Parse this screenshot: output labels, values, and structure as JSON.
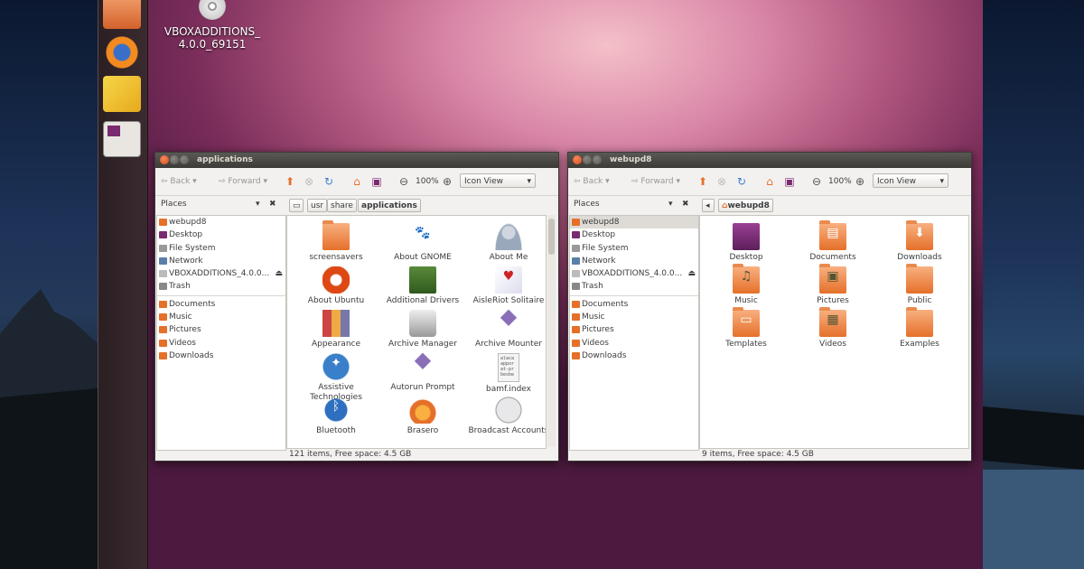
{
  "desktop": {
    "icon_label": "VBOXADDITIONS_\n4.0.0_69151"
  },
  "left_window": {
    "title": "applications",
    "toolbar": {
      "back": "Back",
      "forward": "Forward",
      "zoom": "100%",
      "view": "Icon View"
    },
    "places_label": "Places",
    "path": [
      "usr",
      "share",
      "applications"
    ],
    "sidebar": [
      {
        "label": "webupd8",
        "icon": "home-folder-icon"
      },
      {
        "label": "Desktop",
        "icon": "desktop-icon"
      },
      {
        "label": "File System",
        "icon": "drive-icon"
      },
      {
        "label": "Network",
        "icon": "network-icon"
      },
      {
        "label": "VBOXADDITIONS_4.0.0...",
        "icon": "disc-icon",
        "eject": "⏏"
      },
      {
        "label": "Trash",
        "icon": "trash-icon"
      },
      {
        "label": "Documents",
        "icon": "folder-icon"
      },
      {
        "label": "Music",
        "icon": "folder-icon"
      },
      {
        "label": "Pictures",
        "icon": "folder-icon"
      },
      {
        "label": "Videos",
        "icon": "folder-icon"
      },
      {
        "label": "Downloads",
        "icon": "folder-icon"
      }
    ],
    "files": [
      {
        "label": "screensavers",
        "icon": "folder-icon"
      },
      {
        "label": "About GNOME",
        "icon": "gnome-foot-icon"
      },
      {
        "label": "About Me",
        "icon": "user-info-icon"
      },
      {
        "label": "About Ubuntu",
        "icon": "ubuntu-logo-icon"
      },
      {
        "label": "Additional Drivers",
        "icon": "circuit-board-icon"
      },
      {
        "label": "AisleRiot Solitaire",
        "icon": "cards-icon"
      },
      {
        "label": "Appearance",
        "icon": "appearance-icon"
      },
      {
        "label": "Archive Manager",
        "icon": "archive-icon"
      },
      {
        "label": "Archive Mounter",
        "icon": "diamond-archive-icon"
      },
      {
        "label": "Assistive Technologies",
        "icon": "accessibility-icon"
      },
      {
        "label": "Autorun Prompt",
        "icon": "diamond-archive-icon"
      },
      {
        "label": "bamf.index",
        "icon": "text-file-icon"
      },
      {
        "label": "Bluetooth",
        "icon": "bluetooth-icon"
      },
      {
        "label": "Brasero",
        "icon": "brasero-icon"
      },
      {
        "label": "Broadcast Accounts",
        "icon": "chat-bubble-icon"
      }
    ],
    "text_file_preview": "alaca\nappor\nat-pr\nbesbe",
    "status": "121 items, Free space: 4.5 GB"
  },
  "right_window": {
    "title": "webupd8",
    "toolbar": {
      "back": "Back",
      "forward": "Forward",
      "zoom": "100%",
      "view": "Icon View"
    },
    "places_label": "Places",
    "path": [
      "webupd8"
    ],
    "sidebar": [
      {
        "label": "webupd8",
        "icon": "home-folder-icon"
      },
      {
        "label": "Desktop",
        "icon": "desktop-icon"
      },
      {
        "label": "File System",
        "icon": "drive-icon"
      },
      {
        "label": "Network",
        "icon": "network-icon"
      },
      {
        "label": "VBOXADDITIONS_4.0.0...",
        "icon": "disc-icon",
        "eject": "⏏"
      },
      {
        "label": "Trash",
        "icon": "trash-icon"
      },
      {
        "label": "Documents",
        "icon": "folder-icon"
      },
      {
        "label": "Music",
        "icon": "folder-icon"
      },
      {
        "label": "Pictures",
        "icon": "folder-icon"
      },
      {
        "label": "Videos",
        "icon": "folder-icon"
      },
      {
        "label": "Downloads",
        "icon": "folder-icon"
      }
    ],
    "files": [
      {
        "label": "Desktop",
        "icon": "desktop-folder-icon"
      },
      {
        "label": "Documents",
        "icon": "documents-folder-icon"
      },
      {
        "label": "Downloads",
        "icon": "downloads-folder-icon"
      },
      {
        "label": "Music",
        "icon": "music-folder-icon"
      },
      {
        "label": "Pictures",
        "icon": "pictures-folder-icon"
      },
      {
        "label": "Public",
        "icon": "public-folder-icon"
      },
      {
        "label": "Templates",
        "icon": "templates-folder-icon"
      },
      {
        "label": "Videos",
        "icon": "videos-folder-icon"
      },
      {
        "label": "Examples",
        "icon": "folder-icon"
      }
    ],
    "status": "9 items, Free space: 4.5 GB"
  },
  "launcher": [
    {
      "name": "home-folder-icon"
    },
    {
      "name": "firefox-icon"
    },
    {
      "name": "text-editor-icon"
    },
    {
      "name": "workspace-switcher-icon"
    }
  ]
}
